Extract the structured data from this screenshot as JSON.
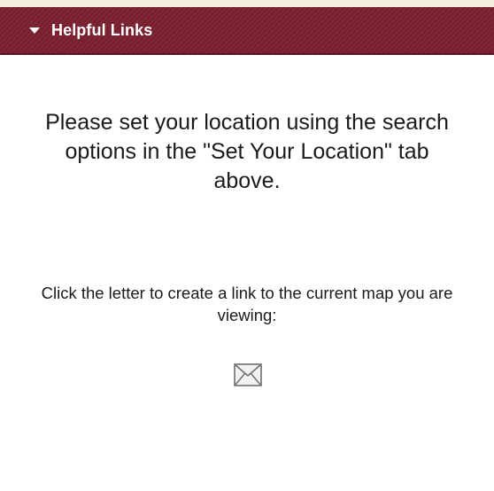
{
  "panel": {
    "title": "Helpful Links",
    "header_color": "#7a1f2f",
    "header_icon": "caret-down-icon"
  },
  "content": {
    "location_message": "Please set your location using the search options in the \"Set Your Location\" tab above.",
    "link_message": "Click the letter to create a link to the current map you are viewing:",
    "mail_icon": "envelope-icon"
  }
}
